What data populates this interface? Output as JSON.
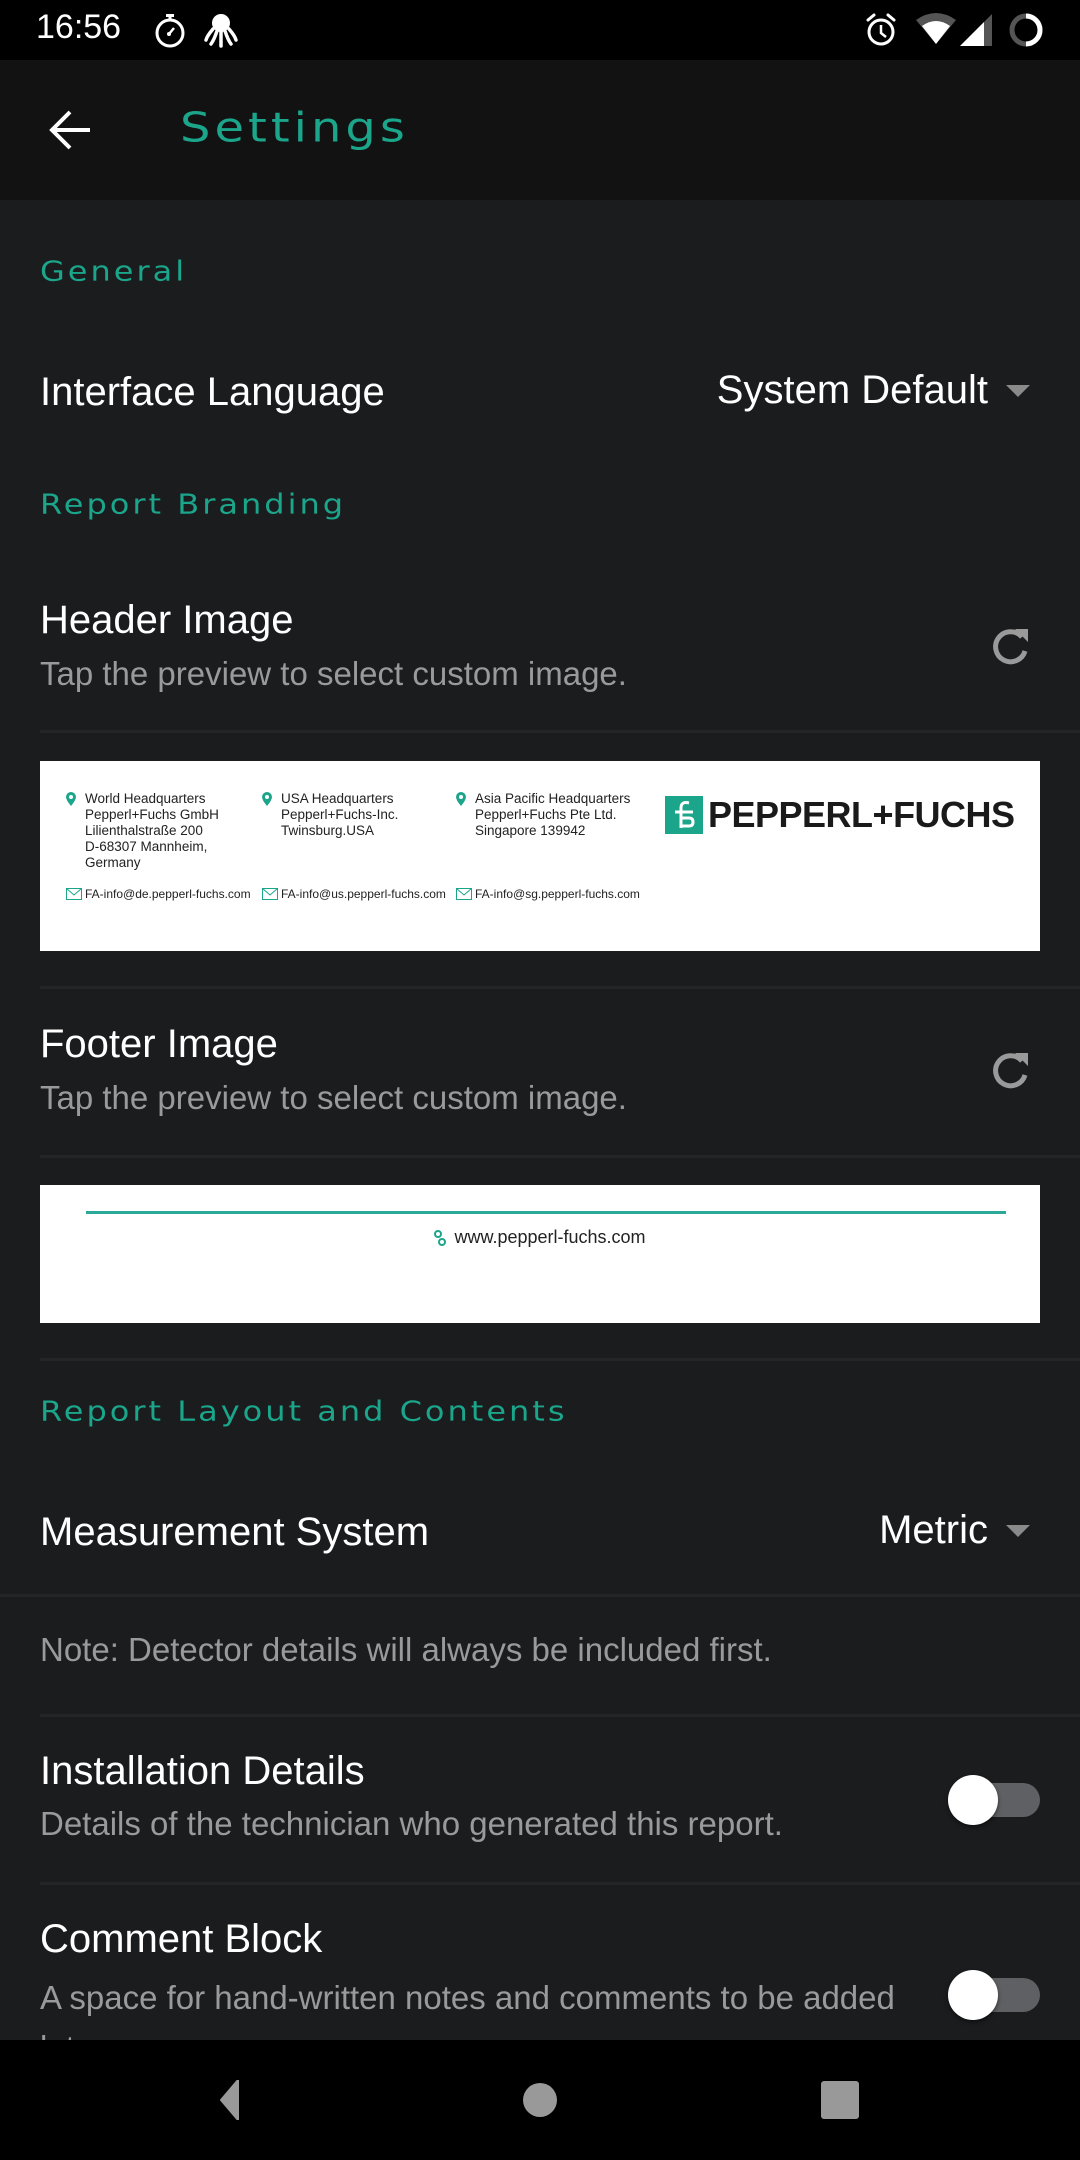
{
  "status_bar": {
    "time": "16:56",
    "icons": [
      "stopwatch-icon",
      "octopus-icon",
      "alarm-icon",
      "wifi-icon",
      "signal-icon",
      "battery-icon"
    ]
  },
  "app_bar": {
    "title": "Settings",
    "back_icon": "arrow-left-icon"
  },
  "colors": {
    "accent": "#1ba58a",
    "background": "#1b1c1e",
    "app_bar": "#121212",
    "subtitle": "#9a9a9a"
  },
  "sections": {
    "general": {
      "header": "General",
      "interface_language": {
        "label": "Interface Language",
        "value": "System Default"
      }
    },
    "report_branding": {
      "header": "Report Branding",
      "header_image": {
        "title": "Header Image",
        "subtitle": "Tap the preview to select custom image.",
        "preview": {
          "offices": [
            {
              "lines": [
                "World Headquarters",
                "Pepperl+Fuchs GmbH",
                "Lilienthalstraße 200",
                "D-68307 Mannheim,",
                "Germany"
              ],
              "email": "FA-info@de.pepperl-fuchs.com"
            },
            {
              "lines": [
                "USA Headquarters",
                "Pepperl+Fuchs-Inc.",
                "Twinsburg.USA"
              ],
              "email": "FA-info@us.pepperl-fuchs.com"
            },
            {
              "lines": [
                "Asia Pacific Headquarters",
                "Pepperl+Fuchs Pte Ltd.",
                "Singapore 139942"
              ],
              "email": "FA-info@sg.pepperl-fuchs.com"
            }
          ],
          "logo_text": "PEPPERL+FUCHS"
        }
      },
      "footer_image": {
        "title": "Footer Image",
        "subtitle": "Tap the preview to select custom image.",
        "preview": {
          "website": "www.pepperl-fuchs.com"
        }
      }
    },
    "report_layout": {
      "header": "Report Layout and Contents",
      "measurement_system": {
        "label": "Measurement System",
        "value": "Metric"
      },
      "note": "Note: Detector details will always be included first.",
      "installation_details": {
        "title": "Installation Details",
        "subtitle": "Details of the technician who generated this report.",
        "enabled": false
      },
      "comment_block": {
        "title": "Comment Block",
        "subtitle": "A space for hand-written notes and comments to be added later.",
        "enabled": false
      }
    }
  },
  "nav_bar": {
    "buttons": [
      "back-nav",
      "home-nav",
      "recents-nav"
    ]
  }
}
